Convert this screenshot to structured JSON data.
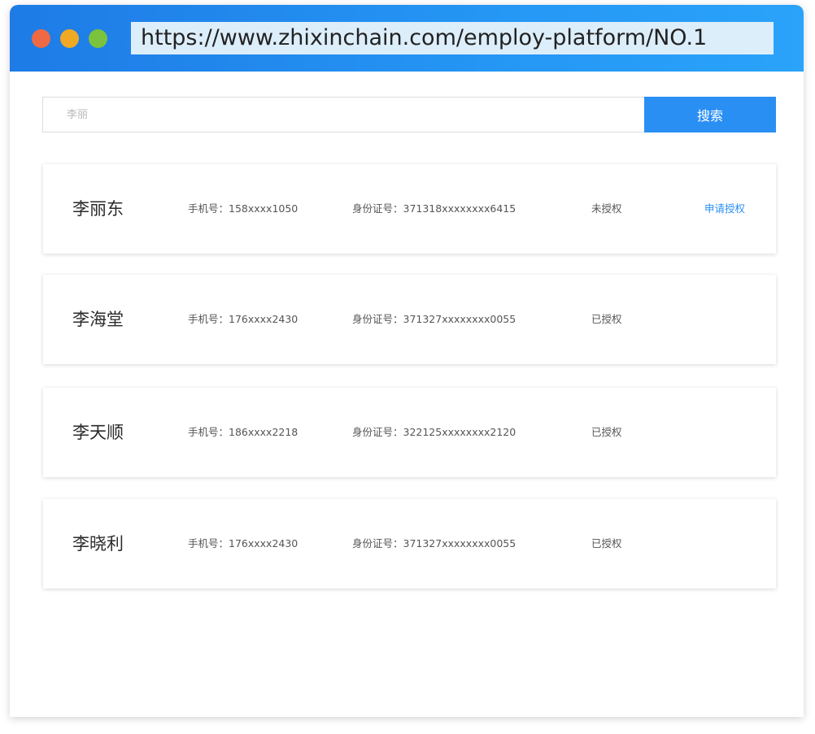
{
  "browser": {
    "url": "https://www.zhixinchain.com/employ-platform/NO.1"
  },
  "search": {
    "placeholder": "李丽",
    "button_label": "搜索"
  },
  "results": [
    {
      "name": "李丽东",
      "phone": "手机号：158xxxx1050",
      "id_number": "身份证号：371318xxxxxxxx6415",
      "status": "未授权",
      "action": "申请授权"
    },
    {
      "name": "李海堂",
      "phone": "手机号：176xxxx2430",
      "id_number": "身份证号：371327xxxxxxxx0055",
      "status": "已授权",
      "action": ""
    },
    {
      "name": "李天顺",
      "phone": "手机号：186xxxx2218",
      "id_number": "身份证号：322125xxxxxxxx2120",
      "status": "已授权",
      "action": ""
    },
    {
      "name": "李晓利",
      "phone": "手机号：176xxxx2430",
      "id_number": "身份证号：371327xxxxxxxx0055",
      "status": "已授权",
      "action": ""
    }
  ],
  "colors": {
    "accent": "#2a8ff3",
    "titlebar": "#2596f4"
  }
}
